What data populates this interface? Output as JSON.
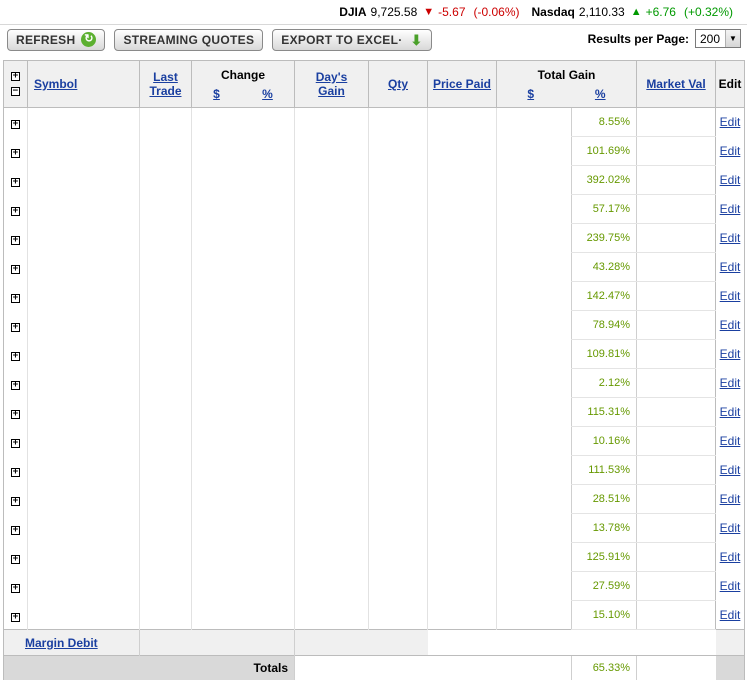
{
  "ticker": [
    {
      "name": "DJIA",
      "value": "9,725.58",
      "direction": "down",
      "change": "-5.67",
      "pct": "(-0.06%)"
    },
    {
      "name": "Nasdaq",
      "value": "2,110.33",
      "direction": "up",
      "change": "+6.76",
      "pct": "(+0.32%)"
    }
  ],
  "toolbar": {
    "refresh_label": "REFRESH",
    "streaming_label": "STREAMING QUOTES",
    "export_label": "EXPORT TO EXCEL",
    "export_mark": "·",
    "results_label": "Results per Page:",
    "results_value": "200"
  },
  "table": {
    "headers": {
      "symbol": "Symbol",
      "last_trade_1": "Last",
      "last_trade_2": "Trade",
      "change": "Change",
      "change_dollar": "$",
      "change_pct": "%",
      "days_gain_1": "Day's",
      "days_gain_2": "Gain",
      "qty": "Qty",
      "price_paid": "Price Paid",
      "total_gain": "Total Gain",
      "total_gain_dollar": "$",
      "total_gain_pct": "%",
      "market_val": "Market Val",
      "edit": "Edit"
    },
    "rows": [
      {
        "gain_pct": "8.55%"
      },
      {
        "gain_pct": "101.69%"
      },
      {
        "gain_pct": "392.02%"
      },
      {
        "gain_pct": "57.17%"
      },
      {
        "gain_pct": "239.75%"
      },
      {
        "gain_pct": "43.28%"
      },
      {
        "gain_pct": "142.47%"
      },
      {
        "gain_pct": "78.94%"
      },
      {
        "gain_pct": "109.81%"
      },
      {
        "gain_pct": "2.12%"
      },
      {
        "gain_pct": "115.31%"
      },
      {
        "gain_pct": "10.16%"
      },
      {
        "gain_pct": "111.53%"
      },
      {
        "gain_pct": "28.51%"
      },
      {
        "gain_pct": "13.78%"
      },
      {
        "gain_pct": "125.91%"
      },
      {
        "gain_pct": "27.59%"
      },
      {
        "gain_pct": "15.10%"
      }
    ],
    "edit_label": "Edit",
    "margin_debit_label": "Margin Debit",
    "totals_label": "Totals",
    "totals_gain_pct": "65.33%"
  },
  "colors": {
    "gain": "#669900",
    "link": "#1a3fa0",
    "down": "#cc0000",
    "up": "#009900"
  },
  "icons": {
    "ticker_down": "triangle-down-icon",
    "ticker_up": "triangle-up-icon",
    "refresh": "refresh-icon",
    "export": "arrow-down-icon",
    "expand": "plus-box-icon",
    "collapse": "minus-box-icon"
  }
}
